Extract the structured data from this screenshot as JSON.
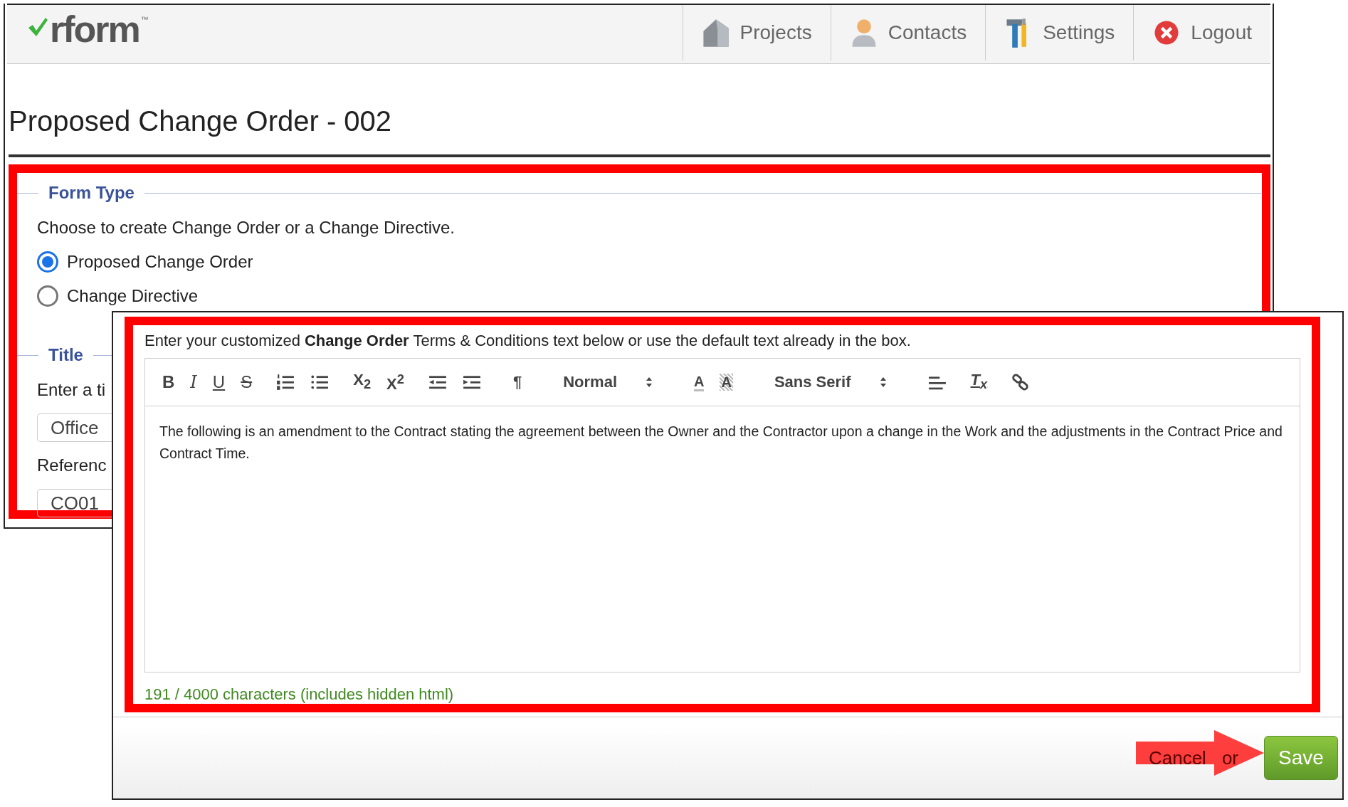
{
  "logo": {
    "text": "rform",
    "mark": "™"
  },
  "nav": [
    {
      "label": "Projects",
      "kind": "house"
    },
    {
      "label": "Contacts",
      "kind": "person"
    },
    {
      "label": "Settings",
      "kind": "tools"
    },
    {
      "label": "Logout",
      "kind": "logout"
    }
  ],
  "page_title": "Proposed Change Order - 002",
  "form_type": {
    "legend": "Form Type",
    "prompt": "Choose to create Change Order or a Change Directive.",
    "options": [
      {
        "label": "Proposed Change Order",
        "selected": true
      },
      {
        "label": "Change Directive",
        "selected": false
      }
    ]
  },
  "title_section": {
    "legend": "Title",
    "prompt": "Enter a ti",
    "value": "Office"
  },
  "reference": {
    "label": "Referenc",
    "value": "CO01"
  },
  "terms": {
    "intro": "Enter your customized **Change Order** Terms & Conditions text below or use the default text already in the box.",
    "toolbar": [
      [
        {
          "kind": "bold",
          "glyph": "B"
        },
        {
          "kind": "italic",
          "glyph": "I"
        },
        {
          "kind": "underline",
          "glyph": "U"
        },
        {
          "kind": "strike",
          "glyph": "S"
        }
      ],
      [
        {
          "kind": "ordered-list"
        },
        {
          "kind": "bullet-list"
        }
      ],
      [
        {
          "kind": "subscript",
          "glyph": "X$_{2}$"
        },
        {
          "kind": "superscript",
          "glyph": "X$^{2}$"
        }
      ],
      [
        {
          "kind": "outdent"
        },
        {
          "kind": "indent"
        }
      ],
      [
        {
          "kind": "direction",
          "glyph": "¶"
        }
      ],
      [
        {
          "kind": "select",
          "glyph": "Normal"
        }
      ],
      [
        {
          "kind": "color",
          "glyph": "A"
        },
        {
          "kind": "background",
          "glyph": "A"
        }
      ],
      [
        {
          "kind": "select",
          "glyph": "Sans Serif"
        }
      ],
      [
        {
          "kind": "align"
        }
      ],
      [
        {
          "kind": "clean",
          "glyph": "T$_{x}$"
        }
      ],
      [
        {
          "kind": "link"
        }
      ]
    ],
    "body": "The following is an amendment to the Contract stating the agreement between the Owner and the Contractor upon a change in the Work and the adjustments in the Contract Price and Contract Time.",
    "counter": "191 / 4000 characters (includes hidden html)"
  },
  "footer": {
    "cancel": "Cancel",
    "separator": "or",
    "save": "Save"
  }
}
